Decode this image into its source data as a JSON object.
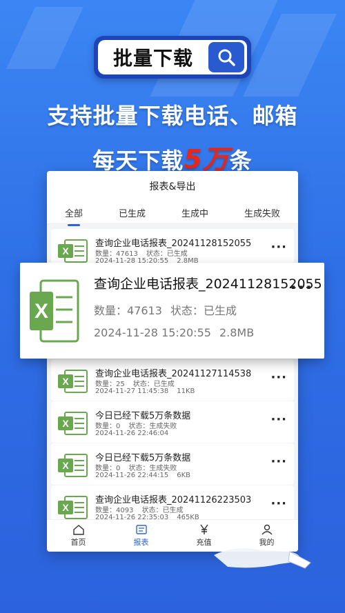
{
  "banner": {
    "search_title": "批量下载",
    "headline1": "支持批量下载电话、邮箱",
    "headline2_prefix": "每天下载",
    "headline2_accent": "5万",
    "headline2_suffix": "条"
  },
  "panel": {
    "title": "报表&导出",
    "tabs": [
      "全部",
      "已生成",
      "生成中",
      "生成失败"
    ],
    "active_tab": 0
  },
  "labels": {
    "count": "数量：",
    "status": "状态：",
    "more": "···"
  },
  "featured": {
    "title": "查询企业电话报表_20241128152055",
    "count_label": "数量：",
    "count": "47613",
    "status_label": "状态：",
    "status": "已生成",
    "date": "2024-11-28 15:20:55",
    "size": "2.8MB"
  },
  "reports": [
    {
      "title": "查询企业电话报表_20241128152055",
      "count": "47613",
      "status": "已生成",
      "date": "2024-11-28 15:20:55",
      "size": "2.8MB"
    },
    {
      "title": "查询企业电话报表_20241127114538",
      "count": "25",
      "status": "已生成",
      "date": "2024-11-27 11:45:38",
      "size": "11KB"
    },
    {
      "title": "今日已经下载5万条数据",
      "count": "0",
      "status": "生成失败",
      "date": "2024-11-26 22:46:04",
      "size": ""
    },
    {
      "title": "今日已经下载5万条数据",
      "count": "0",
      "status": "生成失败",
      "date": "2024-11-26 22:44:15",
      "size": "6KB"
    },
    {
      "title": "查询企业电话报表_20241126223503",
      "count": "4093",
      "status": "已生成",
      "date": "2024-11-26 22:35:03",
      "size": "465KB"
    }
  ],
  "nav": [
    {
      "label": "首页",
      "icon": "home-icon"
    },
    {
      "label": "报表",
      "icon": "report-icon"
    },
    {
      "label": "充值",
      "icon": "yen-icon"
    },
    {
      "label": "我的",
      "icon": "user-icon"
    }
  ],
  "colors": {
    "brand": "#2d63e1",
    "accent": "#e8271a",
    "excel": "#6aa84f"
  }
}
